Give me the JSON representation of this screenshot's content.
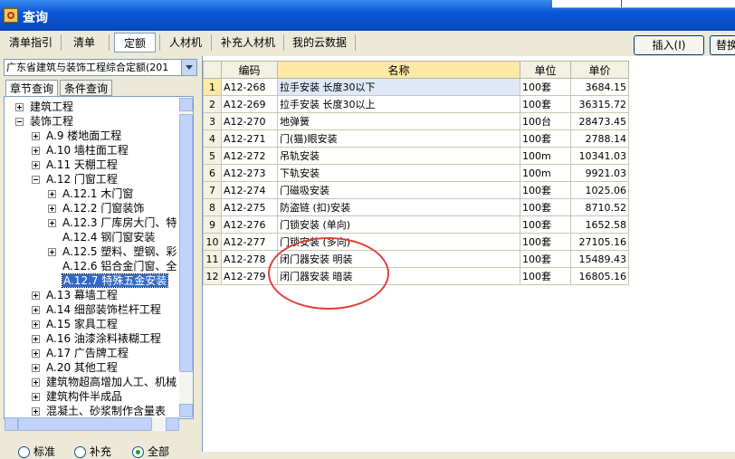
{
  "window": {
    "title": "查询"
  },
  "tabs": [
    {
      "label": "清单指引",
      "selected": false
    },
    {
      "label": "清单",
      "selected": false
    },
    {
      "label": "定额",
      "selected": true
    },
    {
      "label": "人材机",
      "selected": false
    },
    {
      "label": "补充人材机",
      "selected": false
    },
    {
      "label": "我的云数据",
      "selected": false
    }
  ],
  "buttons": {
    "insert": "插入(I)",
    "replace": "替换"
  },
  "left": {
    "quota_library": "广东省建筑与装饰工程综合定额(201",
    "subtabs": [
      "章节查询",
      "条件查询"
    ],
    "tree": [
      {
        "label": "建筑工程",
        "expander": "plus"
      },
      {
        "label": "装饰工程",
        "expander": "minus"
      },
      {
        "label": "A.9 楼地面工程",
        "expander": "plus"
      },
      {
        "label": "A.10 墙柱面工程",
        "expander": "plus"
      },
      {
        "label": "A.11 天棚工程",
        "expander": "plus"
      },
      {
        "label": "A.12 门窗工程",
        "expander": "minus"
      },
      {
        "label": "A.12.1 木门窗",
        "expander": "plus"
      },
      {
        "label": "A.12.2 门窗装饰",
        "expander": "plus"
      },
      {
        "label": "A.12.3 厂库房大门、特",
        "expander": "plus"
      },
      {
        "label": "A.12.4 钢门窗安装",
        "expander": "none"
      },
      {
        "label": "A.12.5 塑料、塑钢、彩",
        "expander": "plus"
      },
      {
        "label": "A.12.6 铝合金门窗、全",
        "expander": "none"
      },
      {
        "label": "A.12.7 特殊五金安装",
        "expander": "none",
        "selected": true
      },
      {
        "label": "A.13 幕墙工程",
        "expander": "plus"
      },
      {
        "label": "A.14 细部装饰栏杆工程",
        "expander": "plus"
      },
      {
        "label": "A.15 家具工程",
        "expander": "plus"
      },
      {
        "label": "A.16 油漆涂料裱糊工程",
        "expander": "plus"
      },
      {
        "label": "A.17 广告牌工程",
        "expander": "plus"
      },
      {
        "label": "A.20 其他工程",
        "expander": "plus"
      },
      {
        "label": "建筑物超高增加人工、机械",
        "expander": "plus"
      },
      {
        "label": "建筑构件半成品",
        "expander": "plus"
      },
      {
        "label": "混凝土、砂浆制作含量表",
        "expander": "plus"
      }
    ],
    "radios": [
      {
        "label": "标准",
        "checked": false
      },
      {
        "label": "补充",
        "checked": false
      },
      {
        "label": "全部",
        "checked": true
      }
    ]
  },
  "table": {
    "headers": [
      "编码",
      "名称",
      "单位",
      "单价"
    ],
    "rows": [
      {
        "no": "1",
        "code": "A12-268",
        "name": "拉手安装 长度30以下",
        "unit": "100套",
        "price": "3684.15"
      },
      {
        "no": "2",
        "code": "A12-269",
        "name": "拉手安装 长度30以上",
        "unit": "100套",
        "price": "36315.72"
      },
      {
        "no": "3",
        "code": "A12-270",
        "name": "地弹簧",
        "unit": "100台",
        "price": "28473.45"
      },
      {
        "no": "4",
        "code": "A12-271",
        "name": "门(猫)眼安装",
        "unit": "100套",
        "price": "2788.14"
      },
      {
        "no": "5",
        "code": "A12-272",
        "name": "吊轨安装",
        "unit": "100m",
        "price": "10341.03"
      },
      {
        "no": "6",
        "code": "A12-273",
        "name": "下轨安装",
        "unit": "100m",
        "price": "9921.03"
      },
      {
        "no": "7",
        "code": "A12-274",
        "name": "门磁吸安装",
        "unit": "100套",
        "price": "1025.06"
      },
      {
        "no": "8",
        "code": "A12-275",
        "name": "防盗链 (扣)安装",
        "unit": "100套",
        "price": "8710.52"
      },
      {
        "no": "9",
        "code": "A12-276",
        "name": "门锁安装 (单向)",
        "unit": "100套",
        "price": "1652.58"
      },
      {
        "no": "10",
        "code": "A12-277",
        "name": "门锁安装 (多向)",
        "unit": "100套",
        "price": "27105.16"
      },
      {
        "no": "11",
        "code": "A12-278",
        "name": "闭门器安装 明装",
        "unit": "100套",
        "price": "15489.43"
      },
      {
        "no": "12",
        "code": "A12-279",
        "name": "闭门器安装 暗装",
        "unit": "100套",
        "price": "16805.16"
      }
    ]
  },
  "colors": {
    "title_bar": "#0a58d8",
    "selection": "#316ac5",
    "annotation_circle": "#e0403a",
    "header_highlight": "#ffe9a6"
  }
}
